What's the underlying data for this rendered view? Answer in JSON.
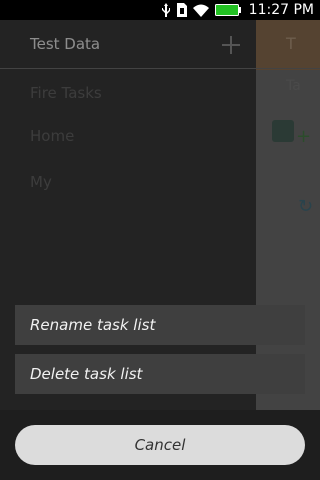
{
  "status_bar": {
    "time": "11:27 PM",
    "icons": [
      "usb-icon",
      "sim-icon",
      "wifi-icon",
      "battery-icon"
    ]
  },
  "drawer": {
    "title": "Test Data",
    "add_icon": "plus",
    "items": [
      "Fire Tasks",
      "Home",
      "My"
    ]
  },
  "main_view": {
    "header_text": "T",
    "subtitle": "Ta"
  },
  "action_menu": {
    "rename_label": "Rename task list",
    "delete_label": "Delete task list",
    "cancel_label": "Cancel"
  },
  "colors": {
    "battery": "#22c022",
    "overlay": "#1e1e1e",
    "button": "#3f3f3f",
    "cancel": "#dcdcdc"
  }
}
